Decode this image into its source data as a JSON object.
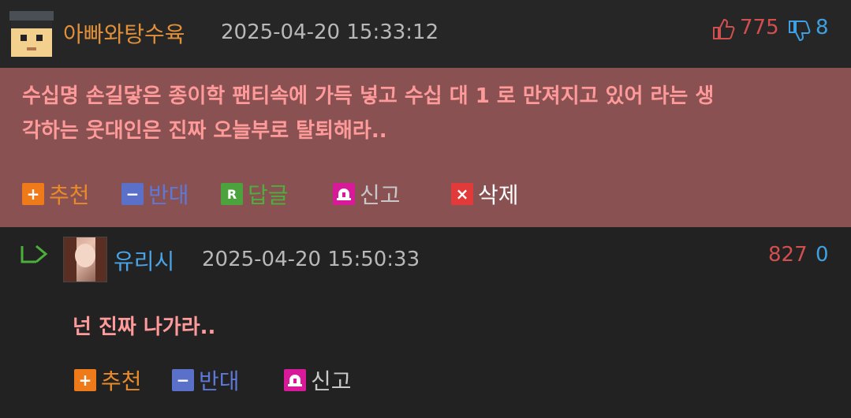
{
  "comment1": {
    "author": "아빠와탕수육",
    "avatar_icon": "pixel-graduate-avatar",
    "datetime": "2025-04-20 15:33:12",
    "upvotes": "775",
    "downvotes": "8",
    "text_line1": "수십명 손길닿은 종이학 팬티속에 가득 넣고 수십 대 1 로 만져지고 있어 라는 생",
    "text_line2": "각하는 웃대인은 진짜 오늘부로 탈퇴해라..",
    "actions": {
      "recommend": "추천",
      "oppose": "반대",
      "reply": "답글",
      "report": "신고",
      "delete": "삭제"
    },
    "highlight_color": "#8a5152"
  },
  "comment2": {
    "author": "유리시",
    "avatar_icon": "profile-photo-avatar",
    "datetime": "2025-04-20 15:50:33",
    "upvotes": "827",
    "downvotes": "0",
    "text": "넌 진짜 나가라..",
    "actions": {
      "recommend": "추천",
      "oppose": "반대",
      "report": "신고"
    }
  },
  "icons": {
    "reply_marker": "reply-arrow-icon",
    "thumbs_up": "thumbs-up-icon",
    "thumbs_down": "thumbs-down-icon",
    "reply_badge": "R"
  },
  "colors": {
    "author1": "#e0903a",
    "author2": "#4aa3e6",
    "upvote": "#d24f4f",
    "downvote": "#3ea0e0",
    "comment_text": "#ff9a9a"
  }
}
